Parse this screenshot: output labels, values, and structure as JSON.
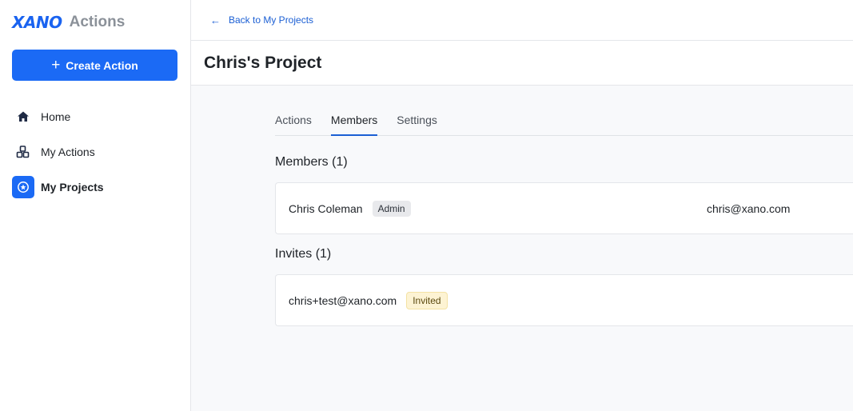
{
  "sidebar": {
    "brand_logo": "XANO",
    "brand_product": "Actions",
    "create_button": "Create Action",
    "items": [
      {
        "label": "Home",
        "icon": "home-icon"
      },
      {
        "label": "My Actions",
        "icon": "cubes-icon"
      },
      {
        "label": "My Projects",
        "icon": "project-icon",
        "active": true
      }
    ]
  },
  "header": {
    "back_link": "Back to My Projects",
    "title": "Chris's Project"
  },
  "tabs": [
    {
      "label": "Actions",
      "active": false
    },
    {
      "label": "Members",
      "active": true
    },
    {
      "label": "Settings",
      "active": false
    }
  ],
  "members": {
    "heading": "Members (1)",
    "rows": [
      {
        "name": "Chris Coleman",
        "badge": "Admin",
        "email": "chris@xano.com"
      }
    ]
  },
  "invites": {
    "heading": "Invites (1)",
    "rows": [
      {
        "email": "chris+test@xano.com",
        "badge": "Invited"
      }
    ]
  },
  "colors": {
    "accent": "#1b6af5",
    "link": "#1b5fd4",
    "invited_badge_bg": "#fdf3d3",
    "admin_badge_bg": "#e8e9ec"
  }
}
